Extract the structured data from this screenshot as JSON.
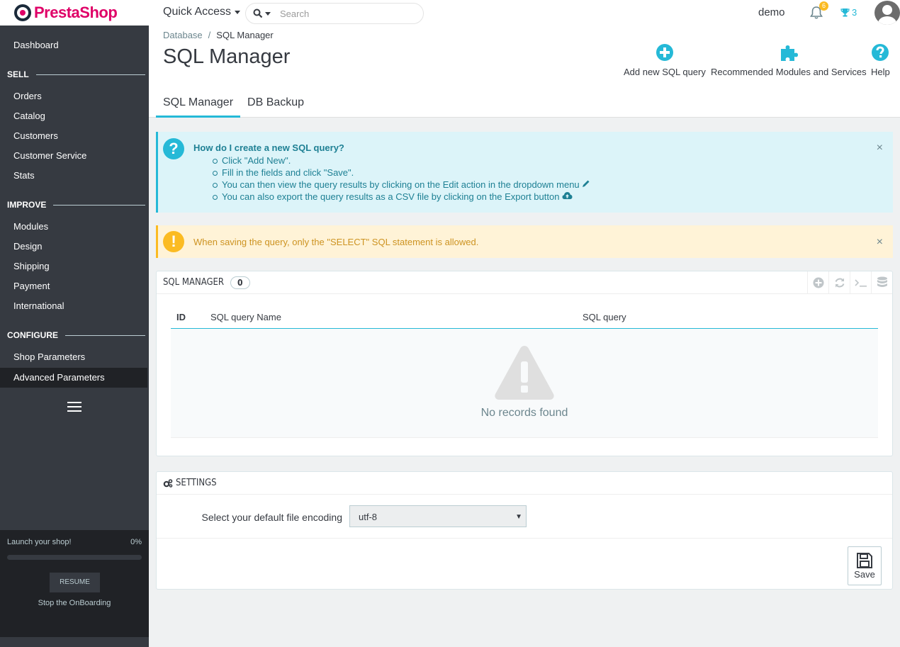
{
  "header": {
    "logo_text": "PrestaShop",
    "quick_access": "Quick Access",
    "search_placeholder": "Search",
    "user_name": "demo",
    "notifications_count": "6",
    "trophy_count": "3"
  },
  "sidebar": {
    "dashboard": "Dashboard",
    "sections": [
      {
        "title": "SELL",
        "items": [
          "Orders",
          "Catalog",
          "Customers",
          "Customer Service",
          "Stats"
        ]
      },
      {
        "title": "IMPROVE",
        "items": [
          "Modules",
          "Design",
          "Shipping",
          "Payment",
          "International"
        ]
      },
      {
        "title": "CONFIGURE",
        "items": [
          "Shop Parameters",
          "Advanced Parameters"
        ]
      }
    ],
    "onboarding": {
      "label": "Launch your shop!",
      "percent": "0%",
      "progress_value": 0,
      "resume": "RESUME",
      "stop": "Stop the OnBoarding"
    }
  },
  "page": {
    "breadcrumb": [
      "Database",
      "SQL Manager"
    ],
    "title": "SQL Manager",
    "toolbar": {
      "add": "Add new SQL query",
      "modules": "Recommended Modules and Services",
      "help": "Help"
    },
    "tabs": [
      "SQL Manager",
      "DB Backup"
    ]
  },
  "info_alert": {
    "title": "How do I create a new SQL query?",
    "items": [
      "Click \"Add New\".",
      "Fill in the fields and click \"Save\".",
      "You can then view the query results by clicking on the Edit action in the dropdown menu",
      "You can also export the query results as a CSV file by clicking on the Export button"
    ]
  },
  "warn_alert": {
    "text": "When saving the query, only the \"SELECT\" SQL statement is allowed."
  },
  "sql_panel": {
    "title": "SQL MANAGER",
    "count": "0",
    "columns": [
      "ID",
      "SQL query Name",
      "SQL query"
    ],
    "empty_text": "No records found"
  },
  "settings_panel": {
    "title": "SETTINGS",
    "label": "Select your default file encoding",
    "selected": "utf-8",
    "save": "Save"
  },
  "colors": {
    "accent": "#25b9d7",
    "sidebar_bg": "#363a41",
    "brand": "#df0067",
    "warning": "#fbbb22"
  }
}
